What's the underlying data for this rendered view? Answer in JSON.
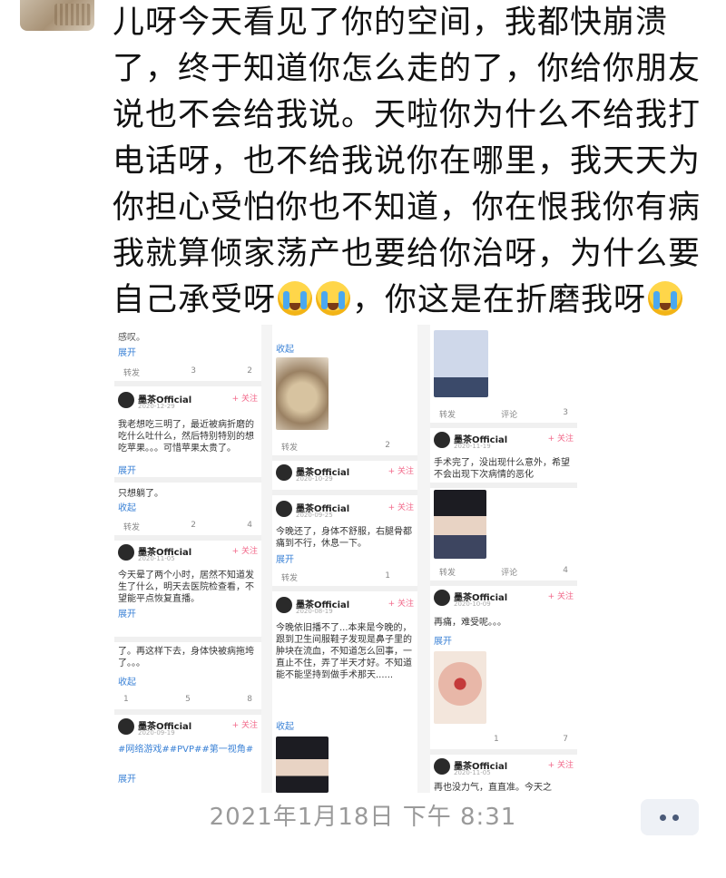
{
  "message": {
    "text_lines": [
      "儿呀今天看见了你的空间，我都快崩溃",
      "了，终于知道你怎么走的了，你给你朋友",
      "说也不会给我说。天啦你为什么不给我打",
      "电话呀，也不给我说你在哪里，我天天为",
      "你担心受怕你也不知道，你在恨我你有病",
      "我就算倾家荡产也要给你治呀，为什么要"
    ],
    "line7_a": "自己承受呀",
    "line7_b": "，你这是在折磨我呀",
    "emoji_name": "loudly-crying-face"
  },
  "collage": {
    "account_name": "墨茶Official",
    "follow": "+ 关注",
    "expand": "展开",
    "collapse": "收起",
    "repost": "转发",
    "comment": "评论",
    "col1": {
      "top_text": "感叹。",
      "acts1": [
        "转发",
        "3",
        "2"
      ],
      "p1_date": "2020-12-29",
      "p1_text": "我老想吃三明了，最近被病折磨的吃什么吐什么，然后特别特别的想吃苹果。。。可惜苹果太贵了。",
      "p2_text": "只想躺了。",
      "acts2": [
        "转发",
        "2",
        "4"
      ],
      "p3_date": "2020-11-05",
      "p3_text": "今天晕了两个小时，居然不知道发生了什么，明天去医院检查看，不望能平点恢复直播。",
      "p4_text": "了。再这样下去，身体快被病拖垮了。。。",
      "acts4": [
        "1",
        "5",
        "8"
      ],
      "p5_date": "2020-09-19",
      "p5_tags": "#网络游戏##PVP##第一视角#"
    },
    "col2": {
      "acts1": [
        "转发",
        "2"
      ],
      "p1_date": "2020-10-29",
      "p2_date": "2020-09-25",
      "p2_text": "今晚还了，身体不舒服，右腿骨都痛到不行，休息一下。",
      "acts2": [
        "转发",
        "1"
      ],
      "p3_date": "2020-08-19",
      "p3_text": "今晚依旧播不了...本来是今晚的，跟到卫生间服鞋子发现是鼻子里的肿块在流血，不知道怎么回事，一直止不住，弄了半天才好。不知道能不能坚持到做手术那天......"
    },
    "col3": {
      "acts1": [
        "转发",
        "评论",
        "3"
      ],
      "p1_date": "2020-11-19",
      "p1_text": "手术完了，没出现什么意外，希望不会出现下次病情的恶化",
      "acts2": [
        "转发",
        "评论",
        "4"
      ],
      "p2_date": "2020-10-09",
      "p2_text": "再痛，难受呢。。。",
      "acts3": [
        "1",
        "7"
      ],
      "p3_date": "2020-11-05",
      "p3_text": "再也没力气，直直准。今天之"
    }
  },
  "footer": {
    "timestamp": "2021年1月18日 下午 8:31",
    "more_icon": "more-dots-icon"
  }
}
